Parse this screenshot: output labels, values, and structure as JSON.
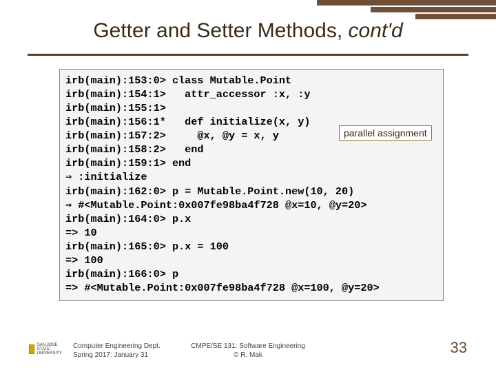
{
  "title_main": "Getter and Setter Methods, ",
  "title_ital": "cont'd",
  "annotation": {
    "parallel": "parallel assignment"
  },
  "code": "irb(main):153:0> class Mutable.Point\nirb(main):154:1>   attr_accessor :x, :y\nirb(main):155:1>\nirb(main):156:1*   def initialize(x, y)\nirb(main):157:2>     @x, @y = x, y\nirb(main):158:2>   end\nirb(main):159:1> end\n⇒ :initialize\nirb(main):162:0> p = Mutable.Point.new(10, 20)\n⇒ #<Mutable.Point:0x007fe98ba4f728 @x=10, @y=20>\nirb(main):164:0> p.x\n=> 10\nirb(main):165:0> p.x = 100\n=> 100\nirb(main):166:0> p\n=> #<Mutable.Point:0x007fe98ba4f728 @x=100, @y=20>",
  "footer": {
    "left_line1": "Computer Engineering Dept.",
    "left_line2": "Spring 2017: January 31",
    "mid_line1": "CMPE/SE 131: Software Engineering",
    "mid_line2": "© R. Mak",
    "page": "33",
    "logo_text": "SAN JOSE STATE\nUNIVERSITY"
  }
}
